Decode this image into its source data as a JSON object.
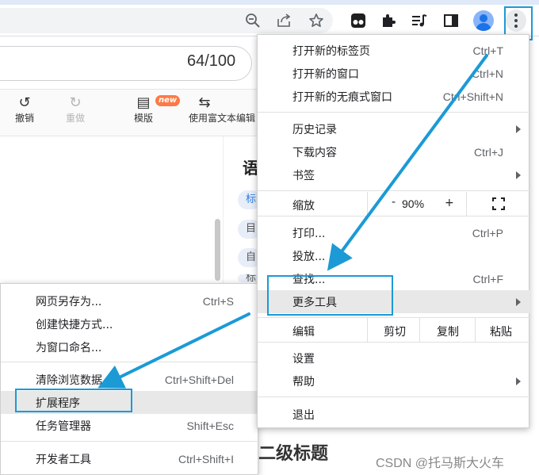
{
  "toolbar": {
    "icons": [
      "zoom-icon",
      "share-icon",
      "bookmark-star-icon",
      "tampermonkey-icon",
      "extensions-puzzle-icon",
      "reading-list-icon",
      "side-panel-icon",
      "profile-avatar-icon",
      "menu-dots-icon"
    ]
  },
  "page": {
    "title_counter": "64/100",
    "editor_tools": [
      {
        "label": "撤销",
        "icon": "↺",
        "disabled": false
      },
      {
        "label": "重做",
        "icon": "↻",
        "disabled": true
      },
      {
        "label": "模版",
        "icon": "▤",
        "disabled": false,
        "badge": "new"
      },
      {
        "label": "使用富文本编辑",
        "icon": "⇆",
        "disabled": false
      }
    ],
    "side_heading": "语",
    "side_chips": [
      "标",
      "目",
      "自",
      "标"
    ],
    "heading2": "二级标题",
    "watermark": "CSDN @托马斯大火车"
  },
  "chrome_menu": {
    "items_group1": [
      {
        "label": "打开新的标签页",
        "shortcut": "Ctrl+T"
      },
      {
        "label": "打开新的窗口",
        "shortcut": "Ctrl+N"
      },
      {
        "label": "打开新的无痕式窗口",
        "shortcut": "Ctrl+Shift+N"
      }
    ],
    "items_group2": [
      {
        "label": "历史记录",
        "shortcut": "",
        "submenu": true
      },
      {
        "label": "下载内容",
        "shortcut": "Ctrl+J",
        "submenu": false
      },
      {
        "label": "书签",
        "shortcut": "",
        "submenu": true
      }
    ],
    "zoom": {
      "label": "缩放",
      "minus": "-",
      "value": "90%",
      "plus": "+"
    },
    "items_group3": [
      {
        "label": "打印...",
        "shortcut": "Ctrl+P",
        "submenu": false
      },
      {
        "label": "投放...",
        "shortcut": "",
        "submenu": false
      },
      {
        "label": "查找...",
        "shortcut": "Ctrl+F",
        "submenu": false
      },
      {
        "label": "更多工具",
        "shortcut": "",
        "submenu": true
      }
    ],
    "edit": {
      "label": "编辑",
      "cut": "剪切",
      "copy": "复制",
      "paste": "粘贴"
    },
    "items_group4": [
      {
        "label": "设置",
        "submenu": false
      },
      {
        "label": "帮助",
        "submenu": true
      }
    ],
    "exit": "退出"
  },
  "more_tools_menu": {
    "items_group1": [
      {
        "label": "网页另存为...",
        "shortcut": "Ctrl+S"
      },
      {
        "label": "创建快捷方式...",
        "shortcut": ""
      },
      {
        "label": "为窗口命名...",
        "shortcut": ""
      }
    ],
    "items_group2": [
      {
        "label": "清除浏览数据...",
        "shortcut": "Ctrl+Shift+Del"
      },
      {
        "label": "扩展程序",
        "shortcut": ""
      },
      {
        "label": "任务管理器",
        "shortcut": "Shift+Esc"
      }
    ],
    "items_group3": [
      {
        "label": "开发者工具",
        "shortcut": "Ctrl+Shift+I"
      }
    ]
  },
  "annotation_color": "#1b9ad6"
}
